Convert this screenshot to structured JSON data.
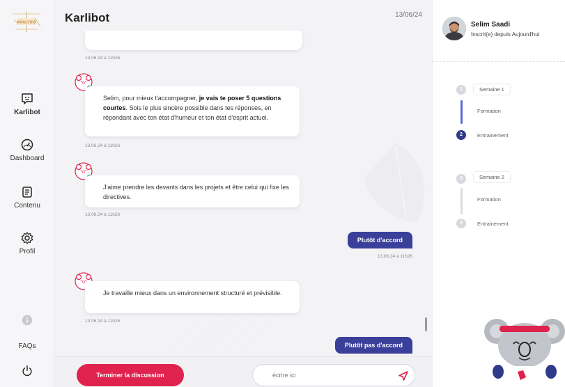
{
  "sidebar": {
    "logo_text": "ANALYSIS",
    "items": [
      {
        "label": "Karlibot",
        "icon": "chat-bot-icon"
      },
      {
        "label": "Dashboard",
        "icon": "gauge-icon"
      },
      {
        "label": "Contenu",
        "icon": "document-icon"
      },
      {
        "label": "Profil",
        "icon": "gear-icon"
      }
    ],
    "faq_label": "FAQs"
  },
  "chat": {
    "title": "Karlibot",
    "date": "13/06/24",
    "messages": [
      {
        "from": "bot",
        "timestamp": "13.06.24 à 11h26"
      },
      {
        "from": "bot",
        "text_pre": "Selim, pour mieux t'accompagner, ",
        "text_bold": "je vais te poser 5 questions courtes",
        "text_post": ". Sois le plus sincère possible dans tes réponses, en répondant avec ton état d'humeur et ton état d'esprit actuel.",
        "timestamp": "13.06.24 à 11h26"
      },
      {
        "from": "bot",
        "text": "J'aime prendre les devants dans les projets et être celui qui fixe les directives.",
        "timestamp": "13.06.24 à 11h26"
      },
      {
        "from": "user",
        "text": "Plutôt d'accord",
        "timestamp": "13.06.24 à 11h26"
      },
      {
        "from": "bot",
        "text": "Je travaille mieux dans un environnement structuré et prévisible.",
        "timestamp": "13.06.24 à 11h26"
      },
      {
        "from": "user",
        "text": "Plutôt pas d'accord"
      }
    ],
    "end_button": "Terminer la discussion",
    "input_placeholder": "écrire ici"
  },
  "profile": {
    "name": "Selim Saadi",
    "subtitle": "Inscrit(e) depuis Aujourd'hui"
  },
  "progress": {
    "steps": [
      {
        "number": "1",
        "label": "Semaine 1",
        "type": "week",
        "status": "done"
      },
      {
        "label": "Formation",
        "type": "step",
        "status": "done"
      },
      {
        "number": "2",
        "label": "Entrainement",
        "type": "step",
        "status": "current"
      },
      {
        "number": "3",
        "label": "Semaine 2",
        "type": "week",
        "status": "todo"
      },
      {
        "label": "Formation",
        "type": "step",
        "status": "todo"
      },
      {
        "number": "4",
        "label": "Entrainement",
        "type": "step",
        "status": "todo"
      }
    ]
  },
  "colors": {
    "accent": "#3a3f9a",
    "danger": "#e0234e",
    "active_step": "#2e3a8a",
    "progress_line": "#5a6ad8",
    "bot_dot": "#1aa37a"
  }
}
